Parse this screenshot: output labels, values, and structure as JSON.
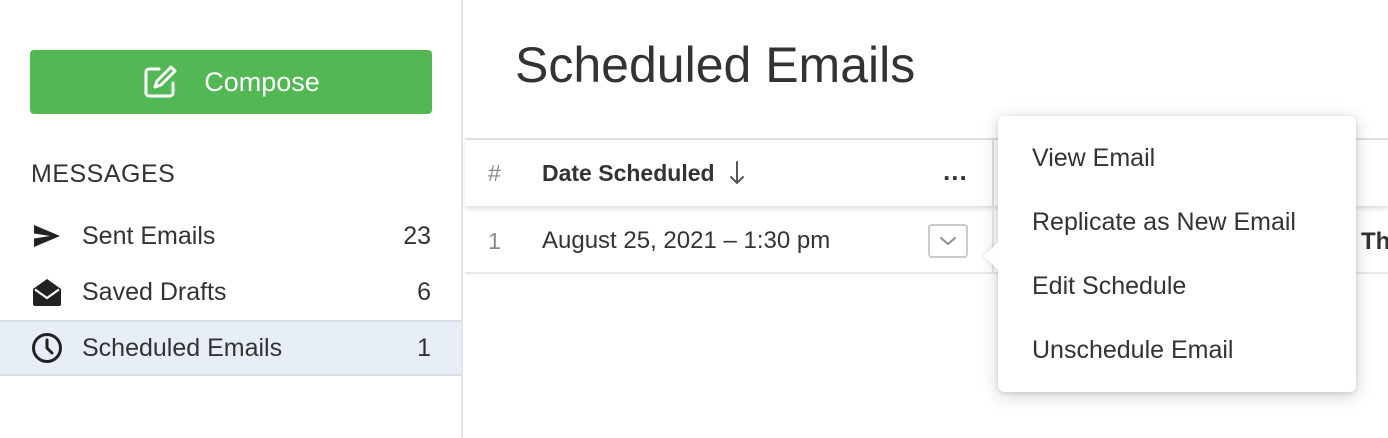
{
  "sidebar": {
    "compose_label": "Compose",
    "section_title": "MESSAGES",
    "items": [
      {
        "label": "Sent Emails",
        "count": "23",
        "icon": "send-icon"
      },
      {
        "label": "Saved Drafts",
        "count": "6",
        "icon": "envelope-open-icon"
      },
      {
        "label": "Scheduled Emails",
        "count": "1",
        "icon": "clock-icon",
        "active": true
      }
    ]
  },
  "main": {
    "title": "Scheduled Emails",
    "table": {
      "headers": {
        "num": "#",
        "date": "Date Scheduled",
        "more": "..."
      },
      "rows": [
        {
          "num": "1",
          "date": "August 25, 2021 – 1:30 pm",
          "extra": "Th"
        }
      ]
    }
  },
  "context_menu": {
    "items": [
      "View Email",
      "Replicate as New Email",
      "Edit Schedule",
      "Unschedule Email"
    ]
  },
  "colors": {
    "accent_green": "#52b854",
    "active_bg": "#e8eef8"
  }
}
